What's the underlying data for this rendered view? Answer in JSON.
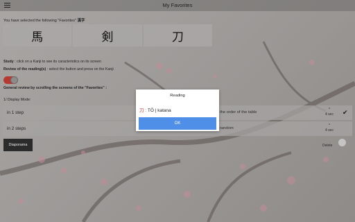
{
  "header": {
    "title": "My Favorites",
    "menu_icon": "hamburger-menu-icon"
  },
  "intro": {
    "prefix": "You have selected the following \"Favorites\" ",
    "kanji_word": "漢字"
  },
  "kanji": [
    "馬",
    "剣",
    "刀"
  ],
  "instructions": {
    "study_bold": "Study",
    "study_text": " : click on a Kanji to see its caracteristics on its screen",
    "review_bold": "Review of the reading(s)",
    "review_text": " : select the button and press on the Kanji",
    "general_review": "General review by scrolling the screens of the \"Favorites\" :",
    "display_mode": "1/ Display Mode:"
  },
  "review_toggle": {
    "on": true,
    "color": "#b43a32"
  },
  "display_modes": [
    {
      "label": "in 1 step",
      "option": "the order of the table",
      "seconds": "4 sec",
      "arrow": "^",
      "checked": true
    },
    {
      "label": "in 2 steps",
      "option": "random",
      "seconds": "4 sec",
      "arrow": "^",
      "checked": false
    }
  ],
  "diaporama_label": "Diaporama",
  "delete_label": "Delete",
  "dialog": {
    "title": "Reading",
    "kanji": "刀",
    "separator": " : ",
    "reading": "TÔ | katana",
    "ok_label": "OK",
    "ok_color": "#4f8fe8"
  }
}
